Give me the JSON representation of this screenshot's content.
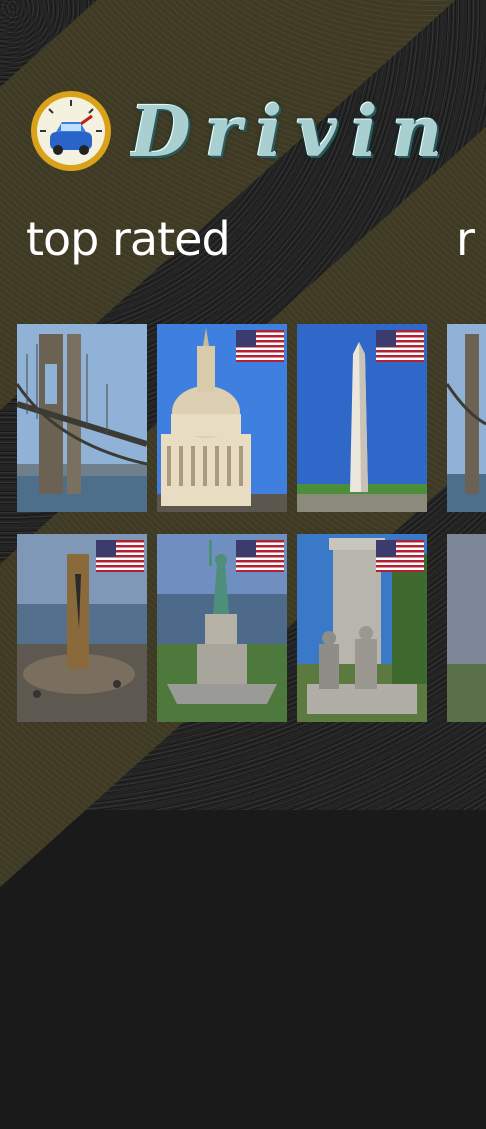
{
  "app": {
    "brand_title": "Drivin",
    "logo_icon": "speedometer-car-icon"
  },
  "sections": {
    "current_title": "top rated",
    "next_title_peek": "r"
  },
  "tiles": [
    {
      "name": "brooklyn-bridge",
      "flag": false
    },
    {
      "name": "state-capitol",
      "flag": true
    },
    {
      "name": "washington-monument",
      "flag": true
    },
    {
      "name": "brooklyn-bridge-partial",
      "flag": false
    },
    {
      "name": "memorial-sculpture",
      "flag": true
    },
    {
      "name": "statue-of-liberty",
      "flag": true
    },
    {
      "name": "monument-with-statues",
      "flag": true
    },
    {
      "name": "landscape-partial",
      "flag": false
    }
  ],
  "colors": {
    "asphalt": "#242424",
    "stripe": "#3e3a24",
    "title_text": "#ffffff",
    "brand_text": "#a9cfd0"
  }
}
